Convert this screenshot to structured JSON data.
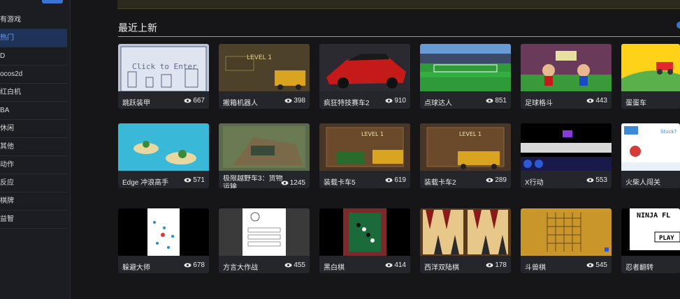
{
  "sidebar": {
    "items": [
      {
        "label": "有游戏",
        "active": false
      },
      {
        "label": "热门",
        "active": true
      },
      {
        "label": "D",
        "active": false
      },
      {
        "label": "ocos2d",
        "active": false
      },
      {
        "label": "红白机",
        "active": false
      },
      {
        "label": "BA",
        "active": false
      },
      {
        "label": "休闲",
        "active": false
      },
      {
        "label": "其他",
        "active": false
      },
      {
        "label": "动作",
        "active": false
      },
      {
        "label": "反应",
        "active": false
      },
      {
        "label": "棋牌",
        "active": false
      },
      {
        "label": "益智",
        "active": false
      }
    ]
  },
  "section": {
    "title": "最近上新"
  },
  "colors": {
    "accent": "#3c74d6",
    "card_bg": "#25262b",
    "active_bg": "#1f3358"
  },
  "games": [
    {
      "title": "跳跃装甲",
      "views": "667"
    },
    {
      "title": "搬箱机器人",
      "views": "398"
    },
    {
      "title": "疯狂特技赛车2",
      "views": "910"
    },
    {
      "title": "点球达人",
      "views": "851"
    },
    {
      "title": "足球格斗",
      "views": "443"
    },
    {
      "title": "蛋蛋车",
      "views": ""
    },
    {
      "title": "Edge 冲浪高手",
      "views": "571"
    },
    {
      "title": "极限越野车3：货物运输",
      "views": "1245"
    },
    {
      "title": "装载卡车5",
      "views": "619"
    },
    {
      "title": "装载卡车2",
      "views": "289"
    },
    {
      "title": "X行动",
      "views": "553"
    },
    {
      "title": "火柴人闯关",
      "views": ""
    },
    {
      "title": "躲避大师",
      "views": "678"
    },
    {
      "title": "方言大作战",
      "views": "455"
    },
    {
      "title": "黑白棋",
      "views": "414"
    },
    {
      "title": "西洋双陆棋",
      "views": "178"
    },
    {
      "title": "斗兽棋",
      "views": "545"
    },
    {
      "title": "忍者翻转",
      "views": ""
    }
  ],
  "thumb_text": {
    "click": "Click to Enter",
    "level": "LEVEL 1",
    "ninja": "NINJA FL",
    "play": "PLAY",
    "stuck": "Stuck?"
  }
}
